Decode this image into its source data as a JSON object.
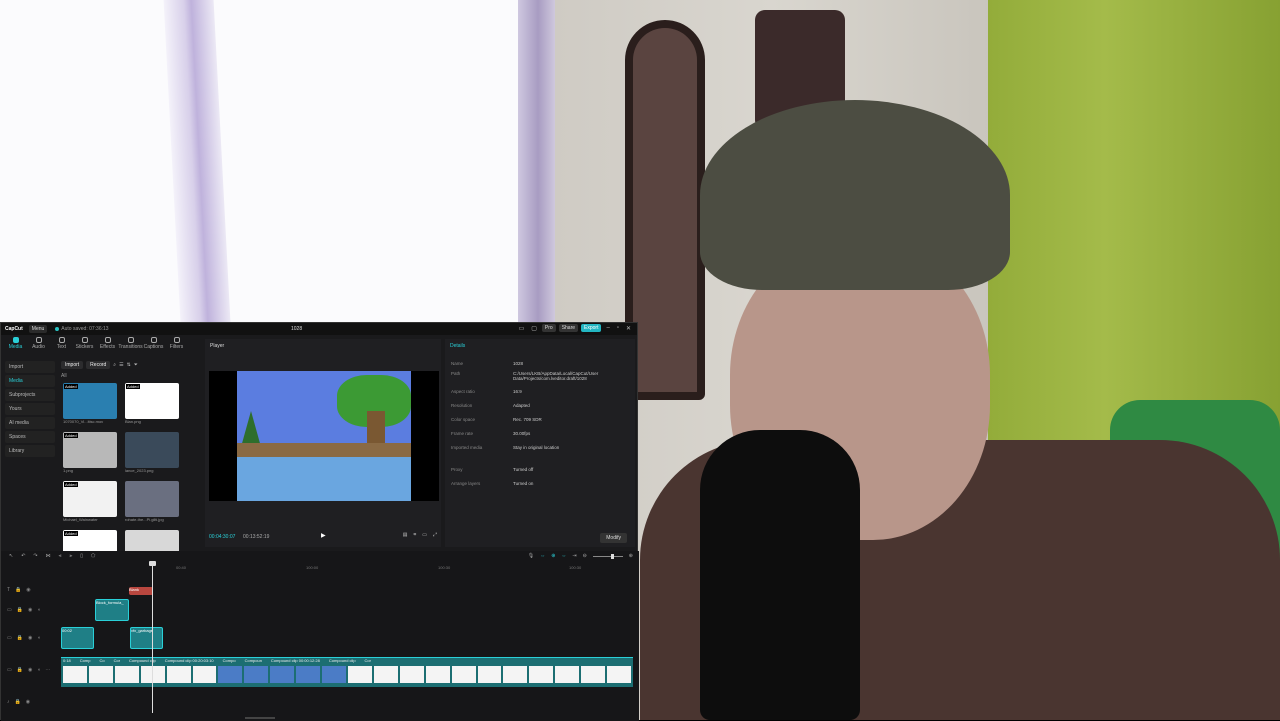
{
  "app": {
    "logo": "CapCut",
    "menu_label": "Menu",
    "autosave": "Auto saved: 07:36:13",
    "project_title": "1028",
    "pro_label": "Pro",
    "share_label": "Share",
    "export_label": "Export"
  },
  "toolbar": [
    "Media",
    "Audio",
    "Text",
    "Stickers",
    "Effects",
    "Transitions",
    "Captions",
    "Filters"
  ],
  "sidebar": [
    "Import",
    "Media",
    "Subprojects",
    "Yours",
    "AI media",
    "Spaces",
    "Library"
  ],
  "media": {
    "import_label": "Import",
    "record_label": "Record",
    "all_label": "All",
    "items": [
      {
        "badge": "Added",
        "name": "1070070_Vi...ltisc.mov",
        "color": "#2a7fb0"
      },
      {
        "badge": "Added",
        "name": "Blan.png",
        "color": "#ffffff"
      },
      {
        "badge": "Added",
        "name": "1.png",
        "color": "#b8b8b8"
      },
      {
        "badge": "",
        "name": "lance_2023.png",
        "color": "#3a4a5a"
      },
      {
        "badge": "Added",
        "name": "Michael_Wainwater",
        "color": "#f2f2f2"
      },
      {
        "badge": "",
        "name": "rohate-the...Pi.gilti.jpg",
        "color": "#6a6f80"
      },
      {
        "badge": "Added",
        "name": "",
        "color": "#ffffff"
      },
      {
        "badge": "",
        "name": "",
        "color": "#d8d8d8"
      }
    ]
  },
  "player": {
    "header": "Player",
    "current_time": "00:04:30:07",
    "duration": "00:13:52:19"
  },
  "details": {
    "header": "Details",
    "rows": [
      {
        "k": "Name",
        "v": "1028"
      },
      {
        "k": "Path",
        "v": "C:/Users/LKB/AppData/Local/CapCut/User Data/Projects/com.lveditor.draft/1028"
      },
      {
        "k": "Aspect ratio",
        "v": "16:9"
      },
      {
        "k": "Resolution",
        "v": "Adapted"
      },
      {
        "k": "Color space",
        "v": "Rec. 709 SDR"
      },
      {
        "k": "Frame rate",
        "v": "30.00fps"
      },
      {
        "k": "Imported media",
        "v": "Stay in original location"
      },
      {
        "k": "Proxy",
        "v": "Turned off"
      },
      {
        "k": "Arrange layers",
        "v": "Turned on"
      }
    ],
    "modify_label": "Modify"
  },
  "timeline": {
    "ruler": [
      "00:40",
      "100:00",
      "100:30",
      "100:30"
    ],
    "text_clip": "Blank",
    "clip_a": "Block_formula_",
    "clip_b": "00:02",
    "clip_c": "vfx_garbage",
    "main_labels": [
      "0:18",
      "Comp",
      "Co",
      "Cor",
      "Compound clip",
      "Compound clip  00:20:03:10",
      "Compo",
      "Compoun",
      "Compound clip  00:00:12:28",
      "Compound clip",
      "Cor"
    ]
  }
}
